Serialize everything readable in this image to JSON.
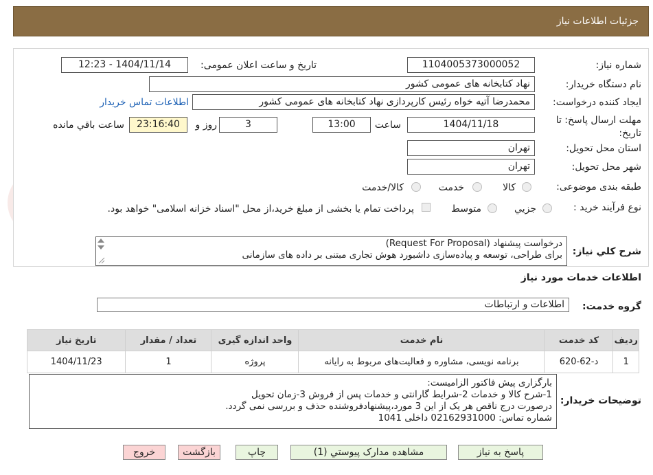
{
  "header": {
    "title": "جزئیات اطلاعات نیاز"
  },
  "form": {
    "need_number_label": "شماره نیاز:",
    "need_number": "1104005373000052",
    "announce_label": "تاریخ و ساعت اعلان عمومی:",
    "announce_value": "1404/11/14 - 12:23",
    "buyer_org_label": "نام دستگاه خریدار:",
    "buyer_org": "نهاد کتابخانه های عمومی کشور",
    "creator_label": "ایجاد کننده درخواست:",
    "creator": "محمدرضا آتیه خواه  رئیس کارپردازی نهاد کتابخانه های عمومی کشور",
    "contact_link": "اطلاعات تماس خریدار",
    "deadline_label": "مهلت ارسال پاسخ: تا تاریخ:",
    "deadline_date": "1404/11/18",
    "time_label": "ساعت",
    "deadline_time": "13:00",
    "days_value": "3",
    "days_label": "روز و",
    "remaining_time": "23:16:40",
    "remaining_label": "ساعت باقي مانده",
    "province_label": "استان محل تحویل:",
    "province": "تهران",
    "city_label": "شهر محل تحویل:",
    "city": "تهران",
    "category_label": "طبقه بندی موضوعی:",
    "category_options": [
      "کالا",
      "خدمت",
      "کالا/خدمت"
    ],
    "process_label": "نوع فرآیند خرید :",
    "process_options": [
      "جزیي",
      "متوسط"
    ],
    "payment_note": "پرداخت تمام یا بخشی از مبلغ خرید،از محل \"اسناد خزانه اسلامی\" خواهد بود."
  },
  "summary": {
    "label": "شرح کلي نياز:",
    "line1": "درخواست پیشنهاد (Request For Proposal)",
    "line2": "برای طراحی، توسعه و پیاده‌سازی داشبورد هوش تجاری مبتنی بر داده های سازمانی"
  },
  "services": {
    "section_title": "اطلاعات خدمات مورد نياز",
    "group_label": "گروه خدمت:",
    "group_value": "اطلاعات و ارتباطات",
    "columns": [
      "رديف",
      "کد خدمت",
      "نام خدمت",
      "واحد اندازه گيری",
      "تعداد / مقدار",
      "تاريخ نياز"
    ],
    "rows": [
      {
        "index": "1",
        "code": "د-62-620",
        "name": "برنامه نویسی، مشاوره و فعالیت‌های مربوط به رایانه",
        "unit": "پروژه",
        "qty": "1",
        "date": "1404/11/23"
      }
    ]
  },
  "buyer_notes": {
    "label": "توضيحات خريدار:",
    "lines": [
      "بارگزاری پیش فاکتور الزامیست:",
      "1-شرح کالا و خدمات 2-شرایط گارانتی و خدمات پس از فروش 3-زمان تحویل",
      "درصورت درج ناقص هر یک از این 3 مورد،پیشنهادفروشنده حذف و بررسی نمی گردد.",
      "شماره تماس: 02162931000 داخلی 1041"
    ]
  },
  "buttons": {
    "reply": "پاسخ به نیاز",
    "attachments": "مشاهده مدارک پیوستي (1)",
    "print": "چاپ",
    "back": "بازگشت",
    "exit": "خروج"
  },
  "colors": {
    "header_bg": "#8a6d44",
    "button_bg": "#e9f5df",
    "button_red": "#fbd4d4",
    "link": "#1a5fb4"
  }
}
